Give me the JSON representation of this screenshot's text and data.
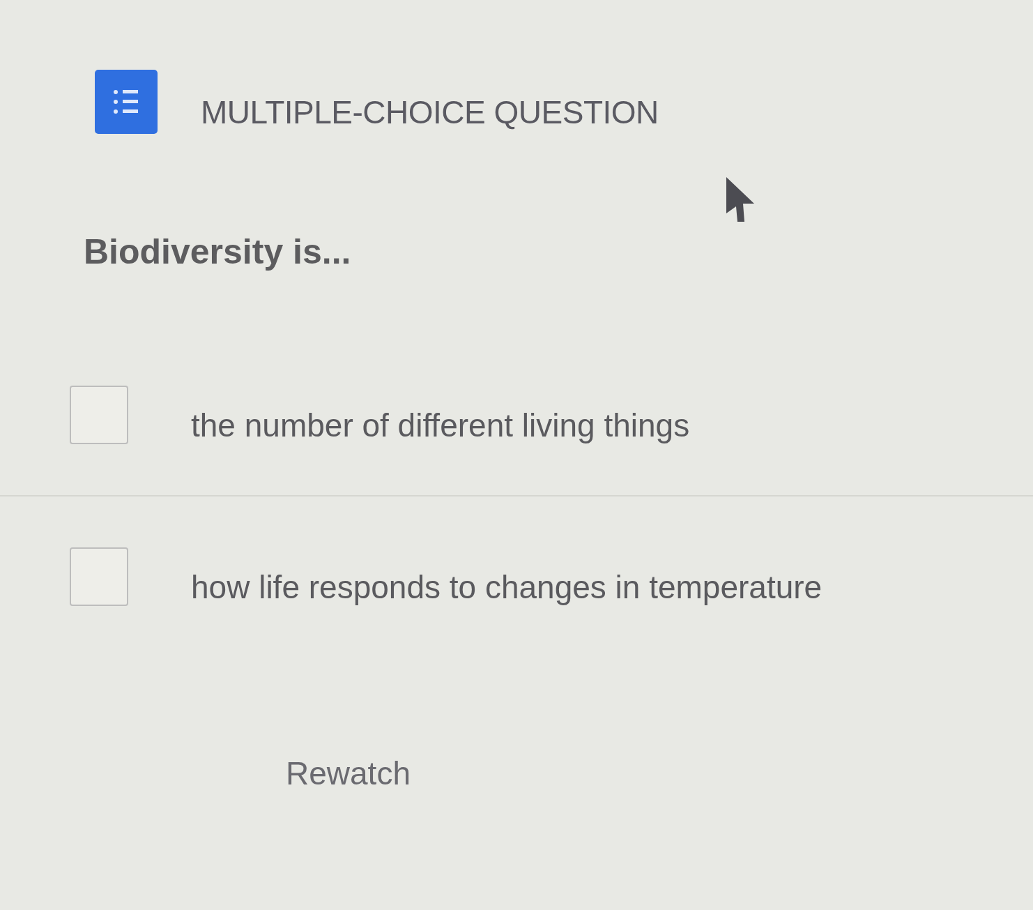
{
  "header": {
    "title": "MULTIPLE-CHOICE QUESTION"
  },
  "question": "Biodiversity is...",
  "options": [
    {
      "text": "the number of different living things",
      "checked": false
    },
    {
      "text": "how life responds to changes in temperature",
      "checked": false
    }
  ],
  "rewatch": "Rewatch"
}
